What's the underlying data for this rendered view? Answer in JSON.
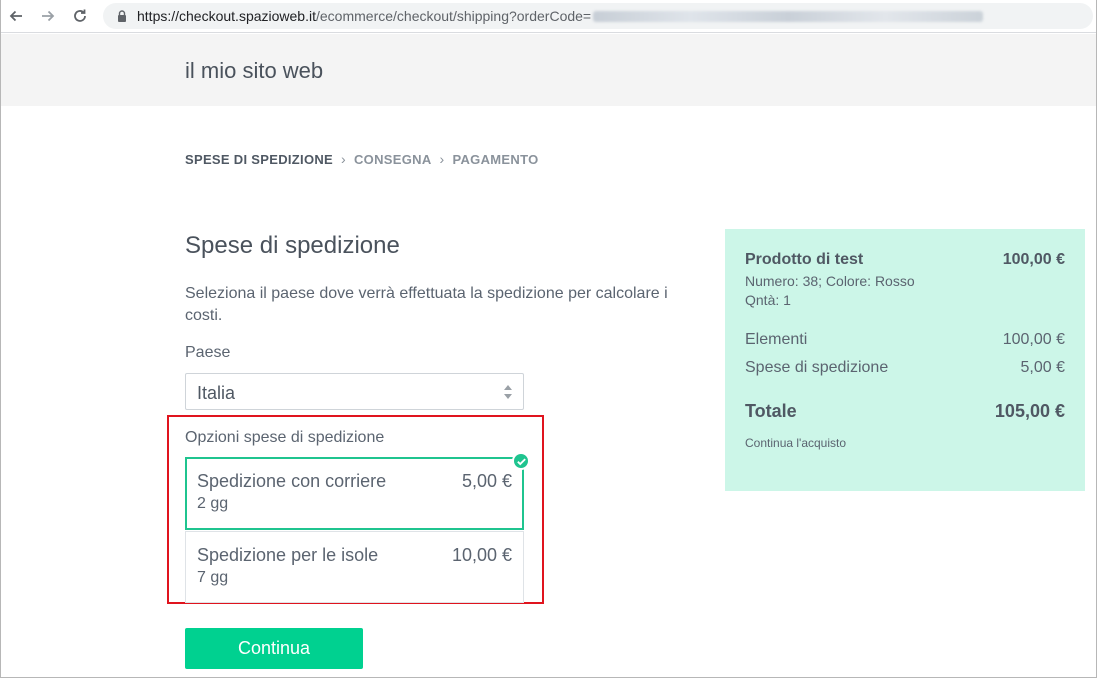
{
  "browser": {
    "url_host": "https://checkout.spazioweb.it",
    "url_path": "/ecommerce/checkout/shipping?orderCode="
  },
  "site": {
    "title": "il mio sito web"
  },
  "breadcrumb": {
    "items": [
      "SPESE DI SPEDIZIONE",
      "CONSEGNA",
      "PAGAMENTO"
    ],
    "separator": "›"
  },
  "shipping": {
    "title": "Spese di spedizione",
    "intro": "Seleziona il paese dove verrà effettuata la spedizione per calcolare i costi.",
    "country_label": "Paese",
    "country_value": "Italia",
    "options_label": "Opzioni spese di spedizione",
    "options": [
      {
        "name": "Spedizione con corriere",
        "days": "2 gg",
        "price": "5,00 €",
        "selected": true
      },
      {
        "name": "Spedizione per le isole",
        "days": "7 gg",
        "price": "10,00 €",
        "selected": false
      }
    ],
    "continue_label": "Continua"
  },
  "summary": {
    "product_name": "Prodotto di test",
    "product_price": "100,00 €",
    "product_attrs": "Numero: 38; Colore: Rosso",
    "product_qty": "Qntà: 1",
    "items_label": "Elementi",
    "items_value": "100,00 €",
    "shipping_label": "Spese di spedizione",
    "shipping_value": "5,00 €",
    "total_label": "Totale",
    "total_value": "105,00 €",
    "continue_shopping": "Continua l'acquisto"
  },
  "colors": {
    "accent_green": "#00d190",
    "summary_bg": "#ccf6e8",
    "highlight_red": "#e0141e"
  }
}
